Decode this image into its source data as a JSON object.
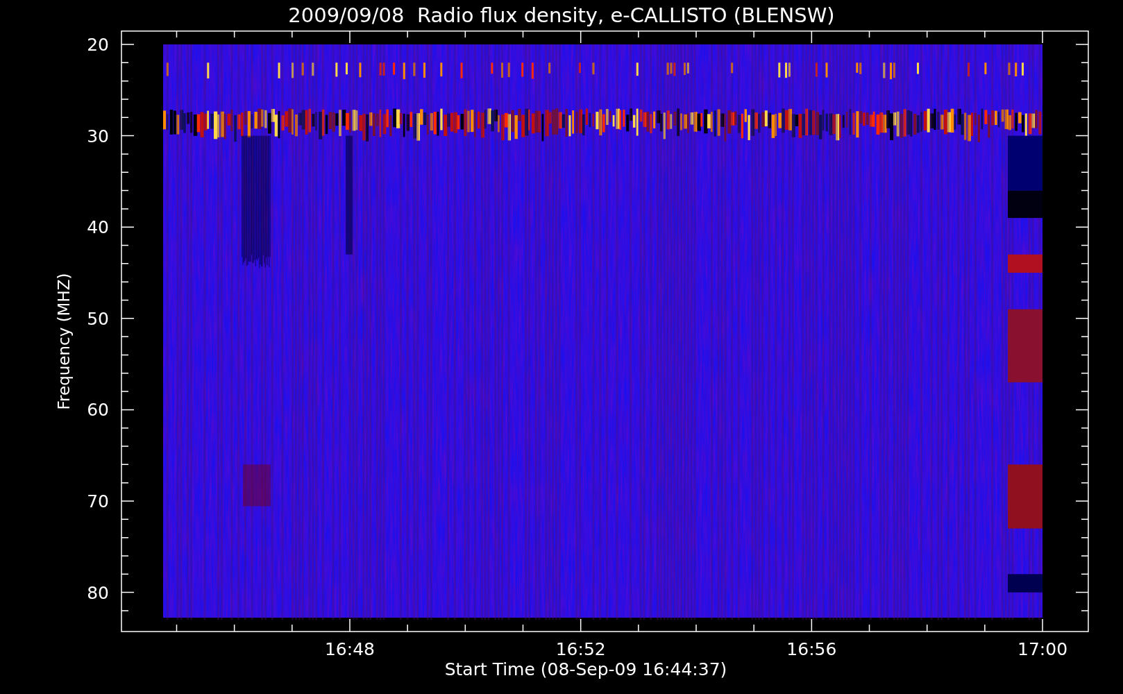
{
  "title": "2009/09/08  Radio flux density, e-CALLISTO (BLENSW)",
  "y_axis": {
    "label": "Frequency (MHZ)",
    "ticks": [
      "20",
      "30",
      "40",
      "50",
      "60",
      "70",
      "80"
    ]
  },
  "x_axis": {
    "label": "Start Time (08-Sep-09 16:44:37)",
    "ticks": [
      "16:48",
      "16:52",
      "16:56",
      "17:00"
    ]
  }
}
